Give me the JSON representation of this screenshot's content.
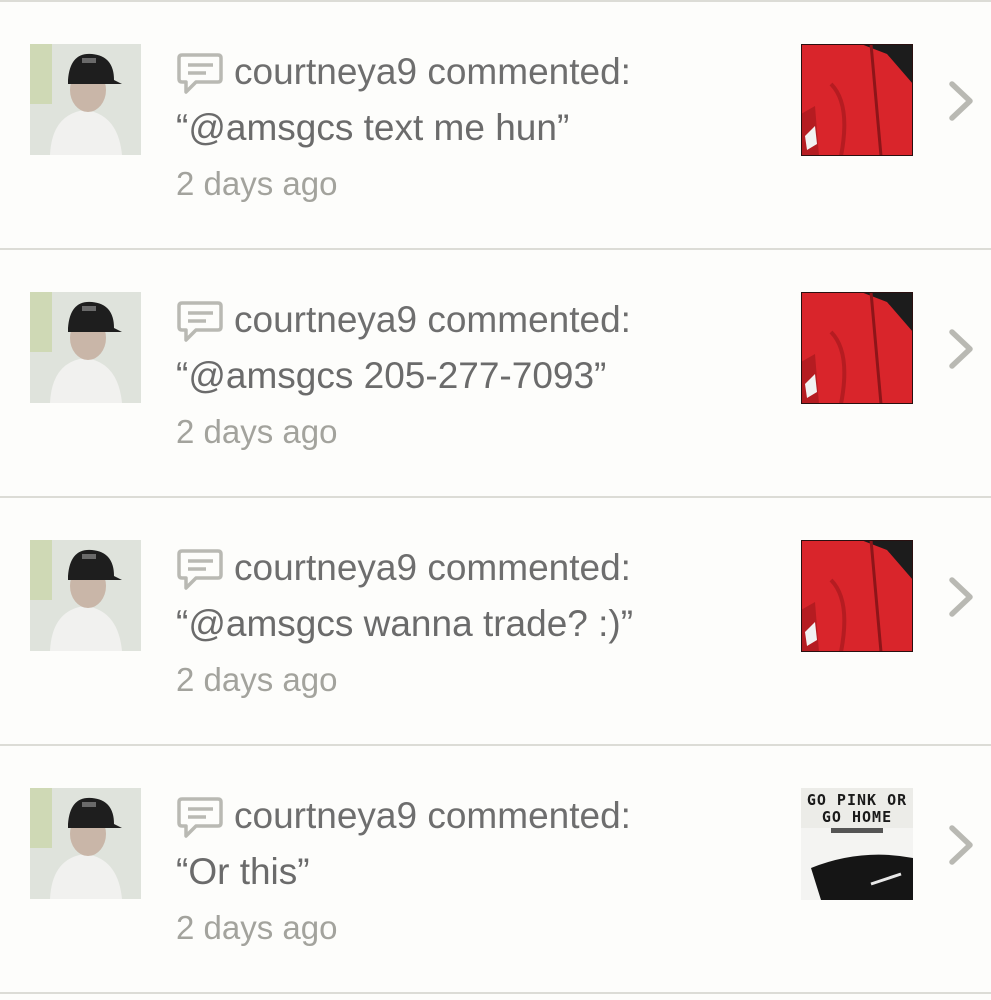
{
  "notifications": [
    {
      "username": "courtneya9",
      "action": "commented:",
      "comment": "“@amsgcs text me hun”",
      "time": "2 days ago",
      "thumbnail": "red-jacket"
    },
    {
      "username": "courtneya9",
      "action": "commented:",
      "comment": "“@amsgcs 205-277-7093”",
      "time": "2 days ago",
      "thumbnail": "red-jacket"
    },
    {
      "username": "courtneya9",
      "action": "commented:",
      "comment": "“@amsgcs wanna trade? :)”",
      "time": "2 days ago",
      "thumbnail": "red-jacket"
    },
    {
      "username": "courtneya9",
      "action": "commented:",
      "comment": "“Or this”",
      "time": "2 days ago",
      "thumbnail": "pink-shirt",
      "thumbnail_text": [
        "GO PINK OR",
        "GO HOME"
      ]
    }
  ],
  "icons": {
    "comment": "comment-bubble-icon",
    "chevron": "chevron-right-icon"
  },
  "colors": {
    "text": "#6e6e6e",
    "time": "#a3a39d",
    "divider": "#dcdcd6",
    "icon": "#b9b9b3",
    "jacket_red": "#d9252b"
  }
}
